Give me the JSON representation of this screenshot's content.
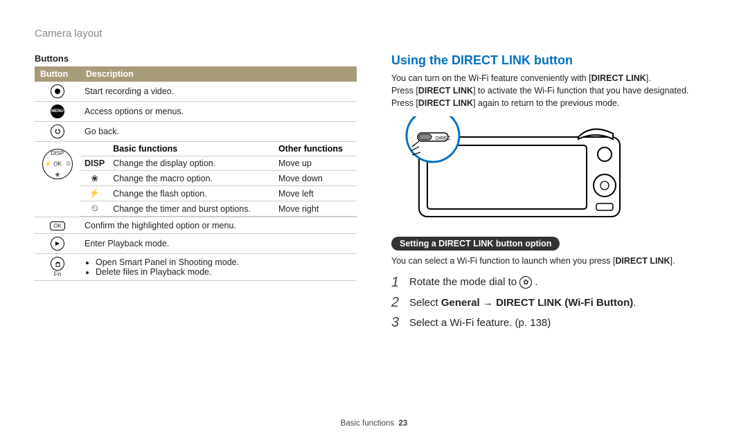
{
  "header": "Camera layout",
  "left": {
    "section": "Buttons",
    "th_button": "Button",
    "th_description": "Description",
    "rows": {
      "record": "Start recording a video.",
      "menu": "Access options or menus.",
      "back": "Go back.",
      "ok": "Confirm the highlighted option or menu.",
      "playback": "Enter Playback mode.",
      "fn1": "Open Smart Panel in Shooting mode.",
      "fn2": "Delete files in Playback mode."
    },
    "nav": {
      "th_icon": "",
      "th_basic": "Basic functions",
      "th_other": "Other functions",
      "disp_label": "DISP",
      "disp_basic": "Change the display option.",
      "disp_other": "Move up",
      "macro_basic": "Change the macro option.",
      "macro_other": "Move down",
      "flash_basic": "Change the flash option.",
      "flash_other": "Move left",
      "timer_basic": "Change the timer and burst options.",
      "timer_other": "Move right"
    },
    "fn_label": "Fn",
    "menu_text": "MENU",
    "ok_text": "OK",
    "ok_wheel": "OK",
    "disp_wheel": "DISP"
  },
  "right": {
    "title": "Using the DIRECT LINK button",
    "p1a": "You can turn on the Wi-Fi feature conveniently with [",
    "p1b": "DIRECT LINK",
    "p1c": "].",
    "p2a": "Press [",
    "p2b": "DIRECT LINK",
    "p2c": "] to activate the Wi-Fi function that you have designated.",
    "p3a": "Press [",
    "p3b": "DIRECT LINK",
    "p3c": "] again to return to the previous mode.",
    "pill": "Setting a DIRECT LINK button option",
    "subp_a": "You can select a Wi-Fi function to launch when you press [",
    "subp_b": "DIRECT LINK",
    "subp_c": "].",
    "step1": "Rotate the mode dial to ",
    "step2a": "Select ",
    "step2b": "General",
    "step2c": " → ",
    "step2d": "DIRECT LINK (Wi-Fi Button)",
    "step2e": ".",
    "step3": "Select a Wi-Fi feature. (p. 138)",
    "direc_label": "DIREC"
  },
  "footer": {
    "label": "Basic functions",
    "page": "23"
  }
}
